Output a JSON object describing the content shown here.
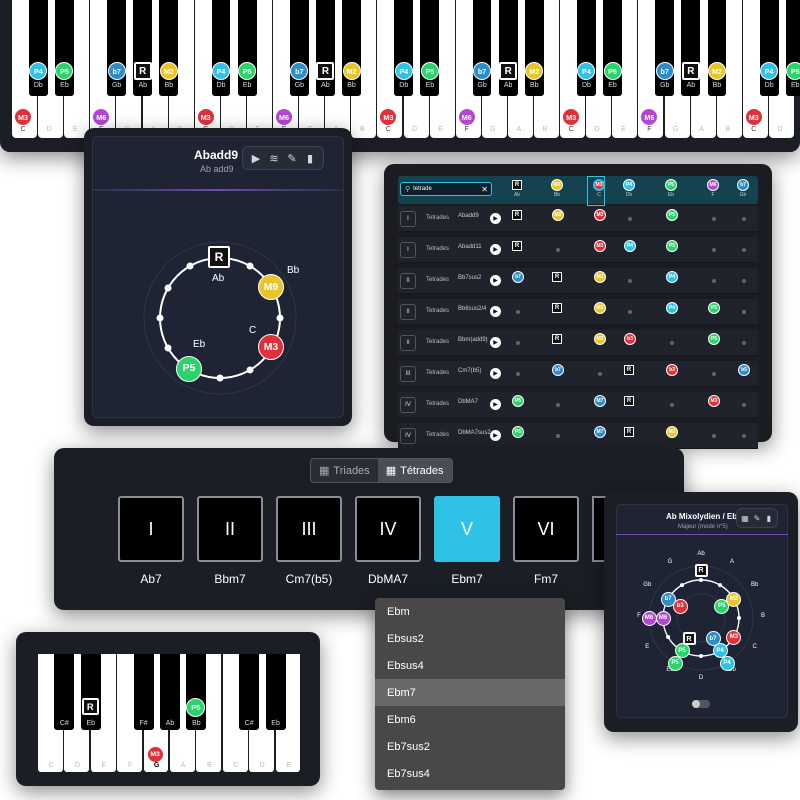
{
  "top_piano": {
    "black_keys": [
      {
        "name": "Db",
        "tag": "P4",
        "color": "#2ec3e6"
      },
      {
        "name": "Eb",
        "tag": "P5",
        "color": "#2bd46b"
      },
      {
        "name": "Gb",
        "tag": "b7",
        "color": "#2c8dc9"
      },
      {
        "name": "Ab",
        "tag": "R",
        "color": ""
      },
      {
        "name": "Bb",
        "tag": "M2",
        "color": "#e8c62b"
      }
    ],
    "white_tags": [
      {
        "name": "C",
        "tag": "M3",
        "color": "#e0303a"
      },
      {
        "name": "F",
        "tag": "M6",
        "color": "#b446d6"
      }
    ],
    "dim_labels": [
      "D",
      "E",
      "G",
      "A",
      "B"
    ]
  },
  "circle_panel": {
    "title": "Abadd9",
    "subtitle": "Ab add9",
    "root_label": "Ab",
    "notes": [
      {
        "tag": "R",
        "name": "Ab"
      },
      {
        "tag": "M9",
        "name": "Bb",
        "color": "#e8c62b"
      },
      {
        "tag": "M3",
        "name": "C",
        "color": "#e0303a"
      },
      {
        "tag": "P5",
        "name": "Eb",
        "color": "#2bd46b"
      }
    ]
  },
  "table_panel": {
    "search": "tetrade",
    "header_cols": [
      {
        "tag": "R",
        "name": "Ab"
      },
      {
        "tag": "M2",
        "name": "Bb",
        "color": "#e8c62b"
      },
      {
        "tag": "M3",
        "name": "C",
        "color": "#e0303a"
      },
      {
        "tag": "P4",
        "name": "Db",
        "color": "#2ec3e6"
      },
      {
        "tag": "P5",
        "name": "Eb",
        "color": "#2bd46b"
      },
      {
        "tag": "M6",
        "name": "F",
        "color": "#b446d6"
      },
      {
        "tag": "b7",
        "name": "Gb",
        "color": "#2c8dc9"
      }
    ],
    "rows": [
      {
        "deg": "I",
        "cat": "Tetrades",
        "name": "Abadd9"
      },
      {
        "deg": "I",
        "cat": "Tetrades",
        "name": "Abadd11"
      },
      {
        "deg": "II",
        "cat": "Tetrades",
        "name": "Bb7sus2"
      },
      {
        "deg": "II",
        "cat": "Tetrades",
        "name": "Bb6sus2/4"
      },
      {
        "deg": "II",
        "cat": "Tetrades",
        "name": "Bbm(add9)"
      },
      {
        "deg": "III",
        "cat": "Tetrades",
        "name": "Cm7(b5)"
      },
      {
        "deg": "IV",
        "cat": "Tetrades",
        "name": "DbMA7"
      },
      {
        "deg": "IV",
        "cat": "Tetrades",
        "name": "DbMA7sus2"
      }
    ]
  },
  "degree_panel": {
    "tabs": [
      "Triades",
      "Tétrades"
    ],
    "active_tab": "Tétrades",
    "degrees": [
      {
        "num": "I",
        "chord": "Ab7"
      },
      {
        "num": "II",
        "chord": "Bbm7"
      },
      {
        "num": "III",
        "chord": "Cm7(b5)"
      },
      {
        "num": "IV",
        "chord": "DbMA7"
      },
      {
        "num": "V",
        "chord": "Ebm7",
        "active": true
      },
      {
        "num": "VI",
        "chord": "Fm7"
      }
    ]
  },
  "dropdown": {
    "options": [
      "Ebm",
      "Ebsus2",
      "Ebsus4",
      "Ebm7",
      "Ebm6",
      "Eb7sus2",
      "Eb7sus4"
    ],
    "selected": "Ebm7"
  },
  "mode_panel": {
    "title": "Ab Mixolydien / Ebm7",
    "subtitle": "Majeur (mode n°5)",
    "outer_notes": [
      "Ab",
      "A",
      "Bb",
      "B",
      "C",
      "Db",
      "D",
      "Eb",
      "E",
      "F",
      "Gb",
      "G"
    ]
  },
  "bottom_piano": {
    "black_labels": [
      "C#",
      "Eb",
      "F#",
      "Ab",
      "Bb"
    ],
    "white_labels": [
      "C",
      "D",
      "E",
      "F",
      "G",
      "A",
      "B",
      "C",
      "D",
      "E"
    ],
    "tags": [
      {
        "tag": "R",
        "name": "Eb"
      },
      {
        "tag": "P5",
        "name": "Bb",
        "color": "#2bd46b"
      },
      {
        "tag": "M3",
        "name": "G",
        "color": "#e0303a"
      }
    ]
  }
}
